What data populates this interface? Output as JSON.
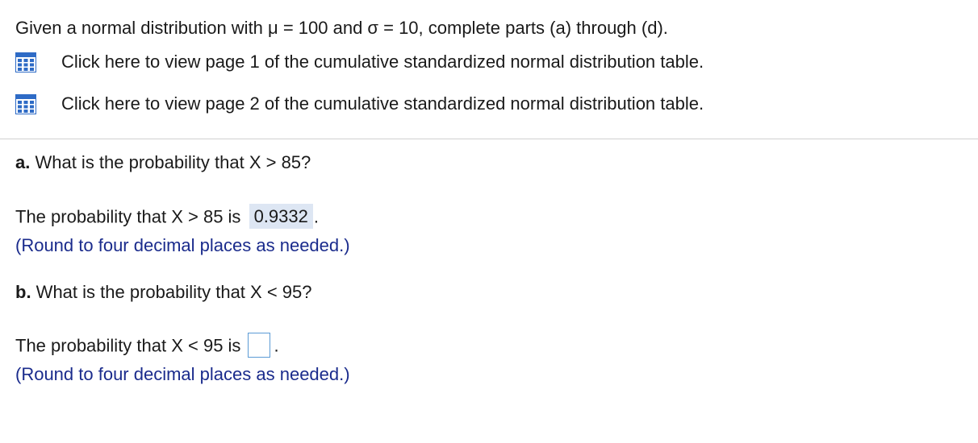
{
  "intro": "Given a normal distribution with μ = 100 and σ = 10, complete parts (a) through (d).",
  "table_links": [
    {
      "label": "Click here to view page 1 of the cumulative standardized normal distribution table.",
      "icon": "table-icon"
    },
    {
      "label": "Click here to view page 2 of the cumulative standardized normal distribution table.",
      "icon": "table-icon"
    }
  ],
  "part_a": {
    "label": "a.",
    "question": " What is the probability that X > 85?",
    "answer_prefix": "The probability that X > 85 is",
    "answer_value": "0.9332",
    "answer_suffix": ".",
    "hint": "(Round to four decimal places as needed.)"
  },
  "part_b": {
    "label": "b.",
    "question": " What is the probability that X < 95?",
    "answer_prefix": "The probability that X < 95 is",
    "answer_value": "",
    "answer_suffix": ".",
    "hint": "(Round to four decimal places as needed.)"
  },
  "colors": {
    "hint_text": "#1a2b8c",
    "answer_highlight": "#dde6f3",
    "input_border": "#5b9bd5",
    "icon_blue": "#2e6bc6"
  }
}
